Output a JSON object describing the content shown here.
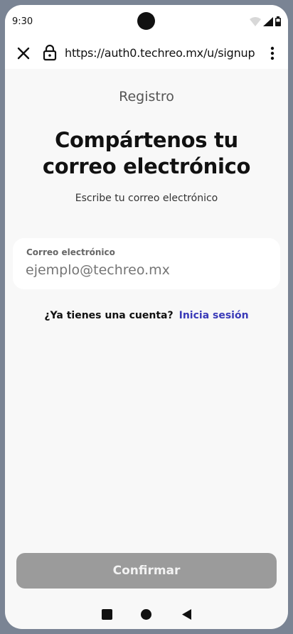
{
  "status": {
    "time": "9:30"
  },
  "browser": {
    "url": "https://auth0.techreo.mx/u/signup"
  },
  "page": {
    "section": "Registro",
    "headline": "Compártenos tu correo electrónico",
    "instruction": "Escribe tu correo electrónico"
  },
  "email_field": {
    "label": "Correo electrónico",
    "placeholder": "ejemplo@techreo.mx"
  },
  "login": {
    "question": "¿Ya tienes una cuenta?",
    "link": "Inicia sesión"
  },
  "confirm": {
    "label": "Confirmar"
  },
  "icons": {
    "close": "close-icon",
    "lock": "lock-icon",
    "more": "more-vert-icon",
    "wifi": "wifi-icon",
    "signal": "signal-icon",
    "battery": "battery-icon",
    "recents": "recents-icon",
    "home": "home-icon",
    "back": "back-icon"
  },
  "colors": {
    "link": "#3a3ab8",
    "button_disabled": "#9b9b9b",
    "frame": "#7a8494"
  }
}
